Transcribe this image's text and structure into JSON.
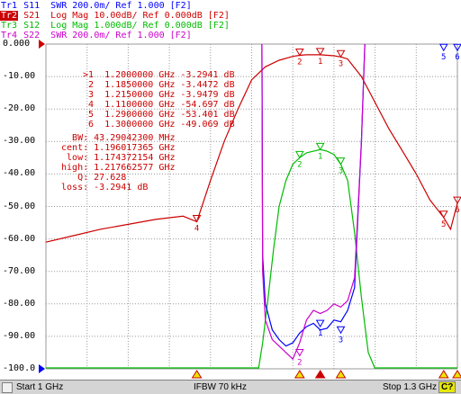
{
  "traces": [
    {
      "id": "Tr1",
      "text": "S11  SWR 200.0m/ Ref 1.000 [F2]",
      "color": "#0000ff",
      "active": false
    },
    {
      "id": "Tr2",
      "text": "S21  Log Mag 10.00dB/ Ref 0.000dB [F2]",
      "color": "#cc0000",
      "active": true
    },
    {
      "id": "Tr3",
      "text": "S12  Log Mag 1.000dB/ Ref 0.000dB [F2]",
      "color": "#00bb00",
      "active": false
    },
    {
      "id": "Tr4",
      "text": "S22  SWR 200.0m/ Ref 1.000 [F2]",
      "color": "#cc00cc",
      "active": false
    }
  ],
  "y_axis": {
    "labels": [
      "0.000",
      "-10.00",
      "-20.00",
      "-30.00",
      "-40.00",
      "-50.00",
      "-60.00",
      "-70.00",
      "-80.00",
      "-90.00",
      "-100.0"
    ],
    "min": -100,
    "max": 0
  },
  "markers": [
    {
      "num": ">1",
      "freq": "1.2000000 GHz",
      "value": "-3.2941 dB"
    },
    {
      "num": "2",
      "freq": "1.1850000 GHz",
      "value": "-3.4472 dB"
    },
    {
      "num": "3",
      "freq": "1.2150000 GHz",
      "value": "-3.9479 dB"
    },
    {
      "num": "4",
      "freq": "1.1100000 GHz",
      "value": "-54.697 dB"
    },
    {
      "num": "5",
      "freq": "1.2900000 GHz",
      "value": "-53.401 dB"
    },
    {
      "num": "6",
      "freq": "1.3000000 GHz",
      "value": "-49.069 dB"
    }
  ],
  "bandwidth": [
    {
      "label": "BW:",
      "value": "43.29042300 MHz"
    },
    {
      "label": "cent:",
      "value": "1.196017365 GHz"
    },
    {
      "label": "low:",
      "value": "1.174372154 GHz"
    },
    {
      "label": "high:",
      "value": "1.217662577 GHz"
    },
    {
      "label": "Q:",
      "value": "27.628"
    },
    {
      "label": "loss:",
      "value": "-3.2941 dB"
    }
  ],
  "status": {
    "start": "Start 1 GHz",
    "ifbw": "IFBW 70 kHz",
    "stop": "Stop 1.3 GHz",
    "cal": "C?"
  },
  "colors": {
    "tr1": "#0000ff",
    "tr2": "#cc0000",
    "tr3": "#00bb00",
    "tr4": "#cc00cc",
    "grid": "#9a9a9a"
  },
  "chart_data": {
    "type": "line",
    "xlabel": "",
    "ylabel": "",
    "xlim": [
      1.0,
      1.3
    ],
    "ylim": [
      -100,
      0
    ],
    "grid": true,
    "series": [
      {
        "name": "S21",
        "color": "#cc0000",
        "x": [
          1.0,
          1.02,
          1.04,
          1.06,
          1.08,
          1.1,
          1.11,
          1.12,
          1.13,
          1.14,
          1.15,
          1.16,
          1.17,
          1.18,
          1.185,
          1.19,
          1.2,
          1.21,
          1.215,
          1.22,
          1.23,
          1.24,
          1.25,
          1.26,
          1.27,
          1.28,
          1.29,
          1.295,
          1.3
        ],
        "y": [
          -61,
          -59,
          -57,
          -55.5,
          -54,
          -53,
          -54.7,
          -42,
          -30,
          -20,
          -11,
          -7,
          -5,
          -3.8,
          -3.45,
          -3.3,
          -3.29,
          -3.6,
          -3.95,
          -4.6,
          -10,
          -18,
          -26,
          -33,
          -40,
          -48,
          -53.4,
          -57,
          -49
        ]
      },
      {
        "name": "S12",
        "color": "#00bb00",
        "x": [
          1.155,
          1.158,
          1.162,
          1.166,
          1.17,
          1.175,
          1.18,
          1.185,
          1.19,
          1.195,
          1.2,
          1.205,
          1.21,
          1.215,
          1.22,
          1.225,
          1.23,
          1.235,
          1.24
        ],
        "y": [
          -100,
          -92,
          -78,
          -63,
          -50,
          -42,
          -37,
          -35,
          -33.5,
          -33,
          -32.5,
          -33,
          -34,
          -37,
          -42,
          -58,
          -78,
          -95,
          -100
        ]
      },
      {
        "name": "S11",
        "color": "#0000ff",
        "x": [
          1.1575,
          1.158,
          1.16,
          1.165,
          1.17,
          1.175,
          1.18,
          1.185,
          1.19,
          1.195,
          1.2,
          1.205,
          1.21,
          1.215,
          1.22,
          1.225,
          1.23,
          1.2325
        ],
        "y": [
          0,
          -65,
          -80,
          -88,
          -91,
          -93,
          -92,
          -89,
          -87,
          -86,
          -88,
          -87.5,
          -85,
          -85.5,
          -82,
          -75,
          -30,
          0
        ]
      },
      {
        "name": "S22",
        "color": "#cc00cc",
        "x": [
          1.1575,
          1.158,
          1.16,
          1.165,
          1.17,
          1.175,
          1.18,
          1.185,
          1.19,
          1.195,
          1.2,
          1.205,
          1.21,
          1.215,
          1.22,
          1.225,
          1.23,
          1.2325
        ],
        "y": [
          0,
          -70,
          -85,
          -91,
          -93,
          -95,
          -97,
          -92,
          -85,
          -82,
          -83,
          -82,
          -80,
          -81,
          -79,
          -72,
          -30,
          0
        ]
      }
    ],
    "marker_points": [
      {
        "label": "1",
        "x": 1.2,
        "y": -3.29,
        "color": "#cc0000"
      },
      {
        "label": "2",
        "x": 1.185,
        "y": -3.45,
        "color": "#cc0000"
      },
      {
        "label": "3",
        "x": 1.215,
        "y": -3.95,
        "color": "#cc0000"
      },
      {
        "label": "4",
        "x": 1.11,
        "y": -54.7,
        "color": "#cc0000"
      },
      {
        "label": "5",
        "x": 1.29,
        "y": -53.4,
        "color": "#cc0000"
      },
      {
        "label": "6",
        "x": 1.3,
        "y": -49.07,
        "color": "#cc0000"
      },
      {
        "label": "1",
        "x": 1.2,
        "y": -32.5,
        "color": "#00bb00"
      },
      {
        "label": "2",
        "x": 1.185,
        "y": -35,
        "color": "#00bb00"
      },
      {
        "label": "3",
        "x": 1.215,
        "y": -37,
        "color": "#00bb00"
      },
      {
        "label": "5",
        "x": 1.29,
        "y": -2,
        "color": "#0000ff"
      },
      {
        "label": "6",
        "x": 1.3,
        "y": -2,
        "color": "#0000ff"
      },
      {
        "label": "1",
        "x": 1.2,
        "y": -87,
        "color": "#0000ff"
      },
      {
        "label": "3",
        "x": 1.215,
        "y": -89,
        "color": "#0000ff"
      },
      {
        "label": "2",
        "x": 1.185,
        "y": -96,
        "color": "#cc00cc"
      }
    ]
  }
}
